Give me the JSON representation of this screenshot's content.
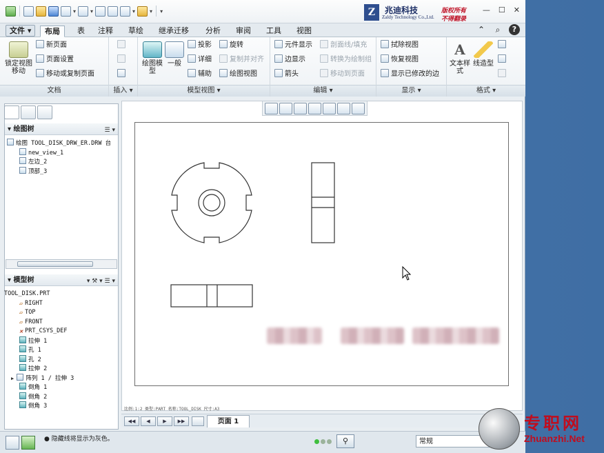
{
  "brand": {
    "logo_letter": "Z",
    "name": "兆迪科技",
    "en": "Zaldy Technology Co.,Ltd.",
    "red1": "版权所有",
    "red2": "不得翻录"
  },
  "menu": {
    "file": "文件",
    "tabs": [
      "布局",
      "表",
      "注释",
      "草绘",
      "继承迁移",
      "分析",
      "审阅",
      "工具",
      "视图"
    ]
  },
  "ribbon": {
    "doc": {
      "lock": "锁定视图移动",
      "new_page": "新页面",
      "page_setup": "页面设置",
      "move_copy": "移动或复制页面",
      "label": "文档"
    },
    "insert": {
      "label": "插入"
    },
    "model_views": {
      "drawing_model": "绘图模型",
      "general": "一般",
      "projection": "投影",
      "detail": "详细",
      "auxiliary": "辅助",
      "revolve": "旋转",
      "copy_align": "复制并对齐",
      "drawing_view": "绘图视图",
      "label": "模型视图"
    },
    "edit": {
      "element_display": "元件显示",
      "edge_display": "边显示",
      "arrow": "箭头",
      "section_fill": "剖面线/填充",
      "convert_drawing": "转换为绘制组",
      "move_to_page": "移动到页面",
      "label": "编辑"
    },
    "display": {
      "erase_view": "拭除视图",
      "restore_view": "恢复视图",
      "show_modified_edges": "显示已修改的边",
      "label": "显示"
    },
    "format": {
      "text_style": "文本样式",
      "line_type": "线造型",
      "label": "格式"
    }
  },
  "drawing_tree": {
    "title": "绘图树",
    "items": [
      "绘图 TOOL_DISK_DRW_ER.DRW 台",
      "new_view_1",
      "左边_2",
      "顶部_3"
    ]
  },
  "model_tree": {
    "title": "模型树",
    "items": [
      "TOOL_DISK.PRT",
      "RIGHT",
      "TOP",
      "FRONT",
      "PRT_CSYS_DEF",
      "拉伸 1",
      "孔 1",
      "孔 2",
      "拉伸 2",
      "阵列 1 / 拉伸 3",
      "倒角 1",
      "倒角 2",
      "倒角 3"
    ]
  },
  "sheet_status": "比例:1:2    类型:PART    名称:TOOL_DISK    尺寸:A3",
  "page_tab": "页面 1",
  "status_message": "隐藏线将显示为灰色。",
  "filter_select": "常规",
  "watermark": {
    "cn": "专职网",
    "en": "Zhuanzhi.Net"
  }
}
